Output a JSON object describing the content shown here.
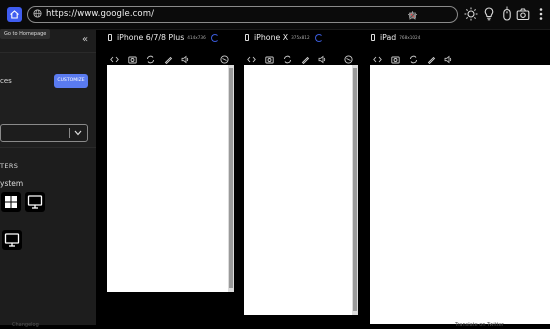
{
  "browser": {
    "url": "https://www.google.com/",
    "tooltip": "Go to Homepage"
  },
  "sidebar": {
    "partial_text_1": "ces",
    "customize_label": "CUSTOMIZE",
    "partial_text_2": "TERS",
    "partial_text_3": "ystem"
  },
  "devices": [
    {
      "name": "iPhone 6/7/8 Plus",
      "dims": "414x736",
      "loading": true
    },
    {
      "name": "iPhone X",
      "dims": "375x812",
      "loading": true
    },
    {
      "name": "iPad",
      "dims": "768x1024",
      "loading": false
    }
  ],
  "footer": {
    "left": "Changelog",
    "right": "Translate on Twitter"
  },
  "colors": {
    "accent": "#5a7bf0",
    "home_button": "#3f5df0"
  }
}
